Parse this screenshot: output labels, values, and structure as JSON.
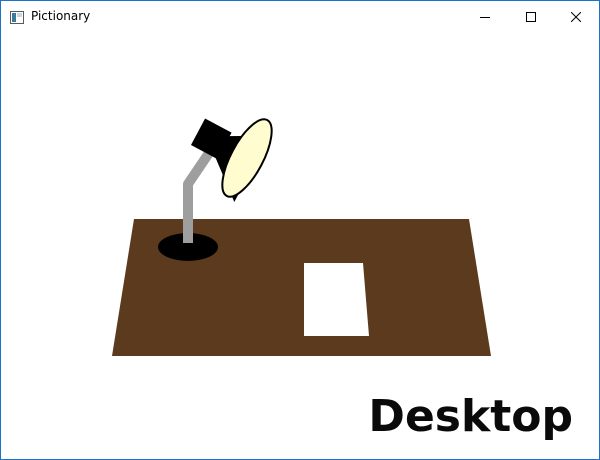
{
  "window": {
    "title": "Pictionary",
    "app_icon": "window-app-icon",
    "controls": {
      "minimize_icon": "minimize-icon",
      "maximize_icon": "maximize-icon",
      "close_icon": "close-icon"
    }
  },
  "drawing": {
    "word": "Desktop",
    "subject": [
      "desk",
      "desk-lamp",
      "paper-sheet"
    ],
    "colors": {
      "desk": "#5c3a1e",
      "lamp_shade": "#000000",
      "lamp_bulb": "#fffdd0",
      "lamp_arm": "#9e9e9e",
      "lamp_base": "#000000",
      "paper": "#ffffff",
      "label": "#0a0a0a",
      "window_border": "#1a73c6"
    }
  }
}
